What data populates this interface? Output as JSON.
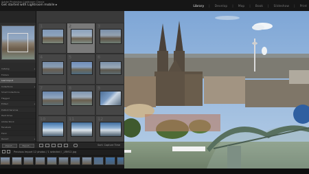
{
  "header": {
    "identity_line1": "Adobe Photoshop Lightroom Classic",
    "identity_line2": "Get started with Lightroom mobile",
    "chevron": "▸",
    "modules": [
      {
        "label": "Library",
        "active": true
      },
      {
        "label": "Develop",
        "active": false
      },
      {
        "label": "Map",
        "active": false
      },
      {
        "label": "Book",
        "active": false
      },
      {
        "label": "Slideshow",
        "active": false
      },
      {
        "label": "Print",
        "active": false
      }
    ],
    "separator": "|"
  },
  "left_panel": {
    "rows": [
      "Catalog",
      "Folders",
      "Last Import",
      "Collections",
      "Smart Collections",
      "Flagged",
      "Edited",
      "Publish Services",
      "Hard Drive",
      "Adobe Stock",
      "Facebook",
      "Flickr",
      "Recent"
    ],
    "triangle": "◂"
  },
  "left_buttons": {
    "import": "Import...",
    "export": "Export..."
  },
  "grid": {
    "toolbar_sort": "Sort: Capture Time",
    "cells": [
      "1",
      "2",
      "3",
      "4",
      "5",
      "6",
      "7",
      "8",
      "9",
      "10",
      "11",
      "12"
    ]
  },
  "filmstrip_bar": {
    "source_text": "Previous Import   12 photos / 1 selected / _LRM12.jpg"
  },
  "colors": {
    "chrome": "#161616",
    "panel": "#2b2b2b",
    "grid_bg": "#3a3a3a",
    "selected_cell": "#7a7a7a",
    "active_module": "#eeeeee"
  }
}
